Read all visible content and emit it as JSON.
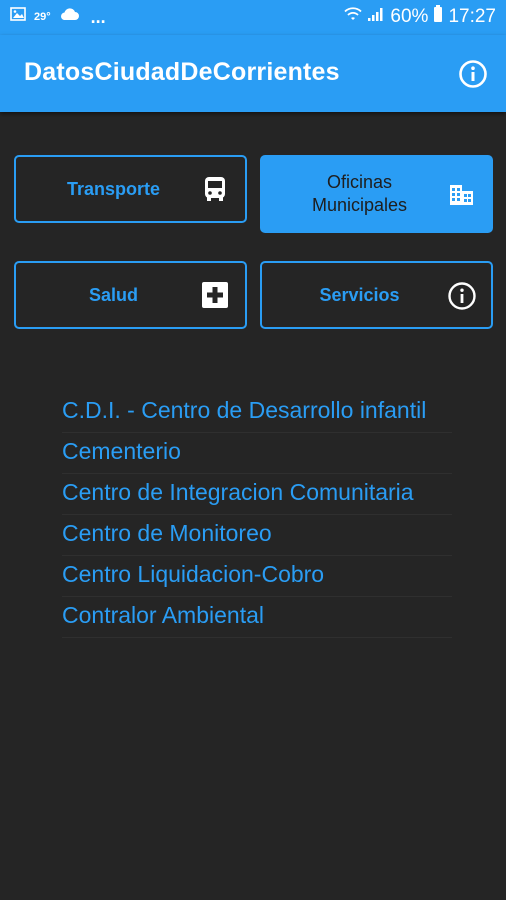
{
  "status_bar": {
    "temperature": "29°",
    "overflow": "...",
    "battery": "60%",
    "time": "17:27",
    "icons": [
      "image-icon",
      "cloud-icon",
      "wifi-icon",
      "signal-icon",
      "battery-icon"
    ]
  },
  "app_bar": {
    "title": "DatosCiudadDeCorrientes",
    "info_icon": "info-icon"
  },
  "categories": [
    {
      "label": "Transporte",
      "icon": "bus-icon",
      "active": false
    },
    {
      "label": "Oficinas Municipales",
      "icon": "building-icon",
      "active": true
    },
    {
      "label": "Salud",
      "icon": "medical-cross-icon",
      "active": false
    },
    {
      "label": "Servicios",
      "icon": "info-icon",
      "active": false
    }
  ],
  "list": {
    "items": [
      "C.D.I. - Centro de Desarrollo infantil",
      "Cementerio",
      "Centro de Integracion Comunitaria",
      "Centro de Monitoreo",
      "Centro Liquidacion-Cobro",
      "Contralor Ambiental"
    ]
  },
  "colors": {
    "accent": "#2a9df4",
    "background": "#252525"
  }
}
